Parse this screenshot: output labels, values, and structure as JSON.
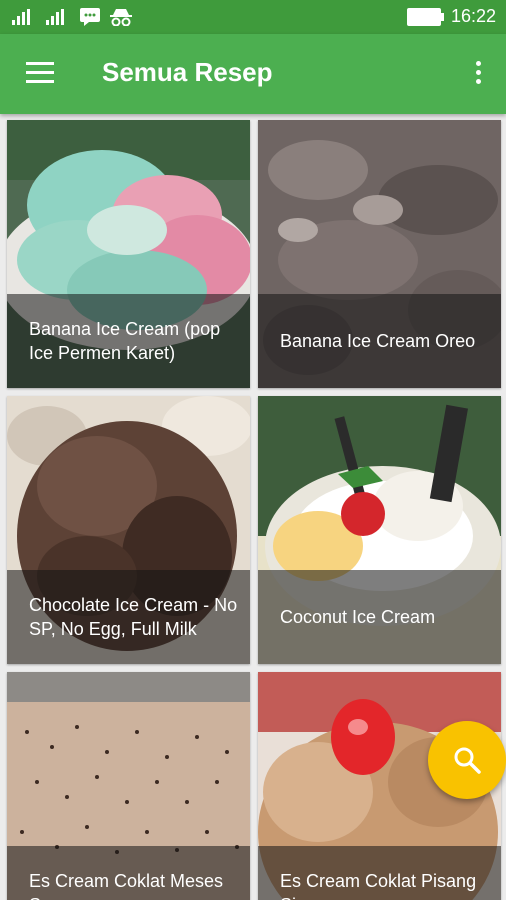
{
  "status_bar": {
    "time": "16:22",
    "icons": [
      "signal-icon",
      "signal-icon",
      "chat-icon",
      "incognito-icon",
      "battery-icon"
    ]
  },
  "app_bar": {
    "title": "Semua Resep",
    "menu_icon": "hamburger-menu-icon",
    "more_icon": "more-vert-icon"
  },
  "recipes": [
    {
      "title": "Banana Ice Cream (pop Ice Permen Karet)"
    },
    {
      "title": "Banana Ice Cream Oreo"
    },
    {
      "title": "Chocolate Ice Cream - No SP, No Egg, Full Milk"
    },
    {
      "title": "Coconut Ice Cream"
    },
    {
      "title": "Es Cream Coklat Meses Sa..."
    },
    {
      "title": "Es Cream Coklat Pisang Si..."
    }
  ],
  "fab": {
    "icon": "search-icon"
  },
  "colors": {
    "status_bar": "#3f9b3c",
    "app_bar": "#4caf50",
    "fab": "#f9c200"
  }
}
